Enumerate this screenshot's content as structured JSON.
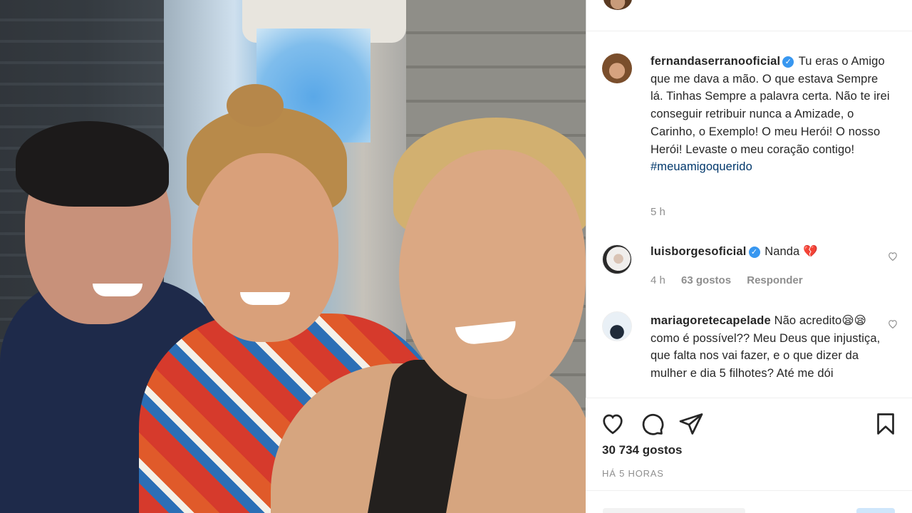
{
  "post": {
    "author": "fernandaserranooficial",
    "caption": "Tu eras o Amigo que me dava a mão. O que estava Sempre lá. Tinhas Sempre a palavra certa. Não te irei conseguir retribuir nunca a Amizade, o Carinho, o Exemplo! O meu Herói! O nosso Herói! Levaste o meu coração contigo!",
    "hashtag": "#meuamigoquerido",
    "time": "5 h",
    "likes": "30 734 gostos",
    "posted_ago": "HÁ 5 HORAS"
  },
  "comments": [
    {
      "user": "luisborgesoficial",
      "verified": true,
      "text": "Nanda 💔",
      "time": "4 h",
      "likes": "63 gostos",
      "reply": "Responder"
    },
    {
      "user": "mariagoretecapelade",
      "verified": false,
      "text": "Não acredito😪😪como é possível?? Meu Deus que injustiça, que falta nos vai fazer, e o que dizer da mulher e dia 5 filhotes? Até me dói"
    }
  ],
  "icons": {
    "verified": "verified-badge-icon",
    "like": "heart-icon",
    "comment": "comment-bubble-icon",
    "share": "paper-plane-icon",
    "save": "bookmark-icon"
  },
  "colors": {
    "verified": "#3897f0",
    "hashtag": "#00376b",
    "muted": "#8e8e8e"
  }
}
